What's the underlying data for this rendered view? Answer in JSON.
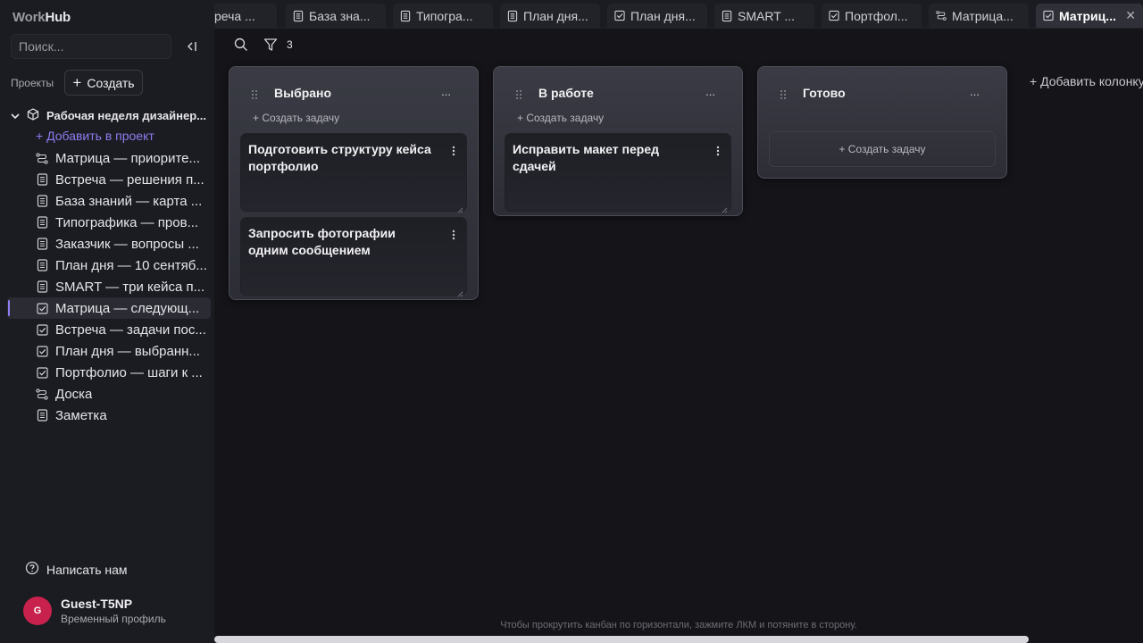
{
  "brand": {
    "part1": "Work",
    "part2": "Hub"
  },
  "sidebar": {
    "search_placeholder": "Поиск...",
    "projects_label": "Проекты",
    "create_label": "Создать",
    "project_name": "Рабочая неделя дизайнер...",
    "add_to_project": "+ Добавить в проект",
    "items": [
      {
        "label": "Матрица — приорите...",
        "icon": "board-icon"
      },
      {
        "label": "Встреча — решения п...",
        "icon": "note-icon"
      },
      {
        "label": "База знаний — карта ...",
        "icon": "note-icon"
      },
      {
        "label": "Типографика — пров...",
        "icon": "note-icon"
      },
      {
        "label": "Заказчик — вопросы ...",
        "icon": "note-icon"
      },
      {
        "label": "План дня — 10 сентяб...",
        "icon": "note-icon"
      },
      {
        "label": "SMART — три кейса п...",
        "icon": "note-icon"
      },
      {
        "label": "Матрица — следующ...",
        "icon": "task-icon",
        "active": true
      },
      {
        "label": "Встреча — задачи пос...",
        "icon": "task-icon"
      },
      {
        "label": "План дня — выбранн...",
        "icon": "task-icon"
      },
      {
        "label": "Портфолио — шаги к ...",
        "icon": "task-icon"
      },
      {
        "label": "Доска",
        "icon": "board-icon"
      },
      {
        "label": "Заметка",
        "icon": "note-icon"
      }
    ],
    "write_us": "Написать нам",
    "user": {
      "initial": "G",
      "name": "Guest-T5NP",
      "subtitle": "Временный профиль"
    }
  },
  "tabs": [
    {
      "label": "реча ...",
      "icon": ""
    },
    {
      "label": "База зна...",
      "icon": "note-icon"
    },
    {
      "label": "Типогра...",
      "icon": "note-icon"
    },
    {
      "label": "План дня...",
      "icon": "note-icon"
    },
    {
      "label": "План дня...",
      "icon": "task-icon"
    },
    {
      "label": "SMART ...",
      "icon": "note-icon"
    },
    {
      "label": "Портфол...",
      "icon": "task-icon"
    },
    {
      "label": "Матрица...",
      "icon": "board-icon"
    },
    {
      "label": "Матриц...",
      "icon": "task-icon",
      "active": true
    }
  ],
  "toolbar": {
    "filter_count": "3"
  },
  "board": {
    "create_task": "+ Создать задачу",
    "menu": "...",
    "columns": [
      {
        "title": "Выбрано",
        "cards": [
          "Подготовить структуру кейса портфолио",
          "Запросить фотографии одним сообщением"
        ]
      },
      {
        "title": "В работе",
        "cards": [
          "Исправить макет перед сдачей"
        ]
      },
      {
        "title": "Готово",
        "cards": []
      }
    ],
    "add_column": "+ Добавить колонку"
  },
  "hint": "Чтобы прокрутить канбан по горизонтали, зажмите ЛКМ и потяните в сторону.",
  "colors": {
    "accent": "#8e7cf0",
    "avatar": "#c8214d",
    "background": "#141419",
    "sidebar": "#1b1c21"
  }
}
